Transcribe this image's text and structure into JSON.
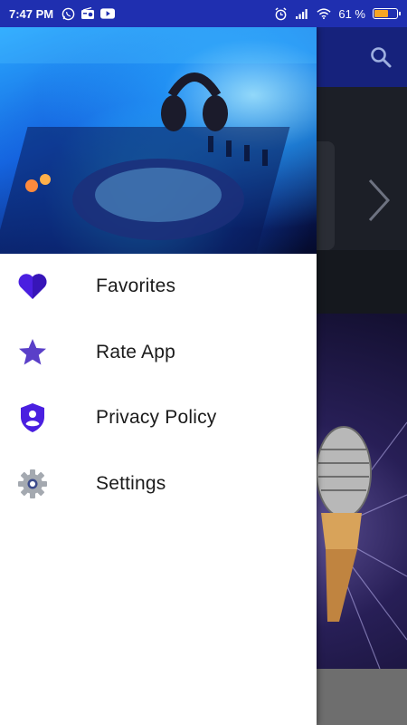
{
  "status_bar": {
    "time": "7:47 PM",
    "battery_percent": "61 %",
    "battery_level": 0.61,
    "icons": [
      "whatsapp-icon",
      "radio-icon",
      "youtube-icon",
      "alarm-icon",
      "signal-icon",
      "wifi-icon"
    ]
  },
  "drawer": {
    "header_image": "dj-mixer-headphones",
    "menu": [
      {
        "label": "Favorites",
        "icon": "heart-icon",
        "color": "#4a1fe0"
      },
      {
        "label": "Rate App",
        "icon": "star-icon",
        "color": "#5a3fc8"
      },
      {
        "label": "Privacy Policy",
        "icon": "shield-user-icon",
        "color": "#4a1fe0"
      },
      {
        "label": "Settings",
        "icon": "gear-icon",
        "color": "#9aa0a6"
      }
    ]
  },
  "colors": {
    "status_bar": "#1f2fb0",
    "toolbar": "#16227c",
    "accent": "#4a1fe0"
  }
}
